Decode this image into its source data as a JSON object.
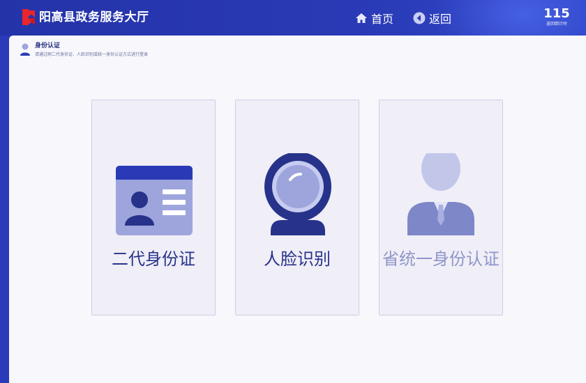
{
  "header": {
    "title": "阳高县政务服务大厅",
    "nav_home": "首页",
    "nav_back": "返回",
    "countdown_value": "115",
    "countdown_label": "返回倒计时"
  },
  "section": {
    "title": "身份认证",
    "description": "请通过刷二代身份证、人脸识别或统一身份认证方式进行登录"
  },
  "cards": [
    {
      "label": "二代身份证",
      "icon": "id-card-icon"
    },
    {
      "label": "人脸识别",
      "icon": "face-camera-icon"
    },
    {
      "label": "省统一身份认证",
      "icon": "person-suit-icon"
    }
  ],
  "colors": {
    "header_bg": "#2a3ab6",
    "accent_dark": "#27338a",
    "accent_light": "#9ea5dc",
    "disabled_text": "#8f96c9"
  }
}
